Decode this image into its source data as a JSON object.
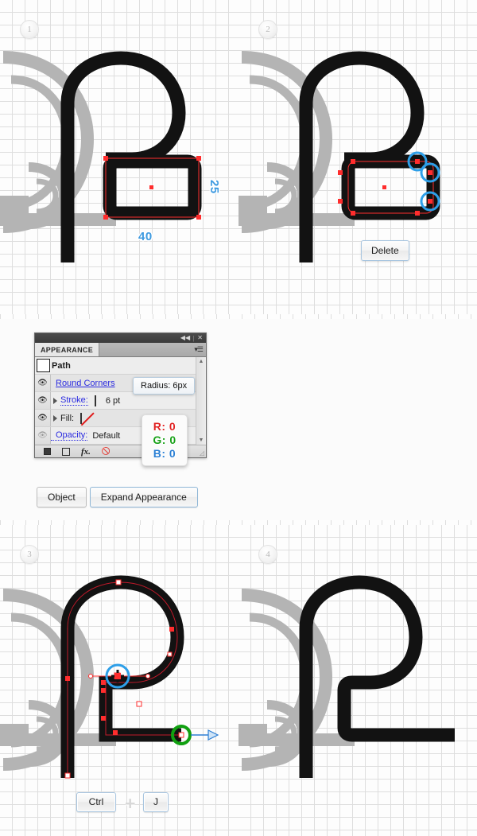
{
  "steps": [
    {
      "number": "1"
    },
    {
      "number": "2"
    },
    {
      "number": "3"
    },
    {
      "number": "4"
    }
  ],
  "panel1": {
    "measure_width": "40",
    "measure_height": "25"
  },
  "panel2": {
    "key_delete": "Delete"
  },
  "panel3": {
    "key_ctrl": "Ctrl",
    "key_plus": "+",
    "key_j": "J"
  },
  "appearance_panel": {
    "titlebar": {
      "collapse_icon": "collapse-icon",
      "separator": "|",
      "close_icon": "close-icon"
    },
    "tab_label": "APPEARANCE",
    "menu_icon": "panel-menu-icon",
    "rows": [
      {
        "name": "path",
        "label": "Path",
        "eye": false,
        "thumb": true
      },
      {
        "name": "round-corners",
        "label": "Round Corners",
        "eye": true,
        "link": true
      },
      {
        "name": "stroke",
        "label": "Stroke:",
        "value": "6 pt",
        "eye": true,
        "link": true,
        "swatch": "black"
      },
      {
        "name": "fill",
        "label": "Fill:",
        "eye": true,
        "swatch": "none"
      },
      {
        "name": "opacity",
        "label": "Opacity:",
        "value": "Default",
        "eye": true,
        "link": true
      }
    ],
    "scroll_up": "▲",
    "scroll_down": "▼",
    "footer_icons": [
      "new-fill-icon",
      "new-stroke-icon",
      "fx-icon",
      "clear-appearance-icon",
      "resize-grip-icon"
    ]
  },
  "tooltips": {
    "radius": "Radius: 6px",
    "rgb_r": "R: 0",
    "rgb_g": "G: 0",
    "rgb_b": "B: 0"
  },
  "buttons": {
    "object": "Object",
    "expand_appearance": "Expand Appearance"
  },
  "colors": {
    "artwork_black": "#121212",
    "artwork_gray": "#b4b4b4",
    "selection_red": "#ff2d2d",
    "anchor_blue": "#2e9fe8",
    "anchor_green": "#11a011",
    "measure_blue": "#3e9ae0",
    "grid_line": "#dedede"
  }
}
